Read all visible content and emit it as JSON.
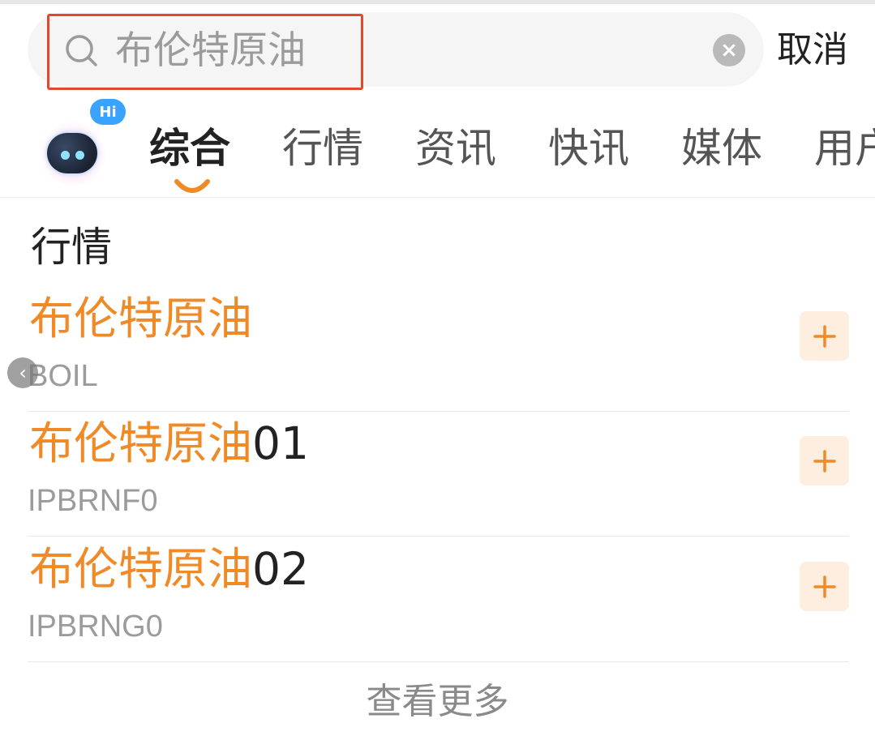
{
  "search": {
    "query": "布伦特原油",
    "cancel_label": "取消",
    "clear_icon": "×"
  },
  "bot": {
    "bubble_label": "Hi"
  },
  "tabs": [
    {
      "label": "综合",
      "active": true
    },
    {
      "label": "行情",
      "active": false
    },
    {
      "label": "资讯",
      "active": false
    },
    {
      "label": "快讯",
      "active": false
    },
    {
      "label": "媒体",
      "active": false
    },
    {
      "label": "用户",
      "active": false
    }
  ],
  "section": {
    "title": "行情"
  },
  "results": [
    {
      "name_highlight": "布伦特原油",
      "name_suffix": "",
      "code": "BOIL"
    },
    {
      "name_highlight": "布伦特原油",
      "name_suffix": "01",
      "code": "IPBRNF0"
    },
    {
      "name_highlight": "布伦特原油",
      "name_suffix": "02",
      "code": "IPBRNG0"
    }
  ],
  "see_more_label": "查看更多",
  "back_handle_glyph": "‹",
  "colors": {
    "accent": "#f08a26",
    "search_border": "#e0482f",
    "add_button_bg": "#fdeee0"
  },
  "icons": {
    "search": "search-icon",
    "clear": "clear-icon",
    "add": "plus-icon",
    "back": "chevron-left-icon"
  }
}
